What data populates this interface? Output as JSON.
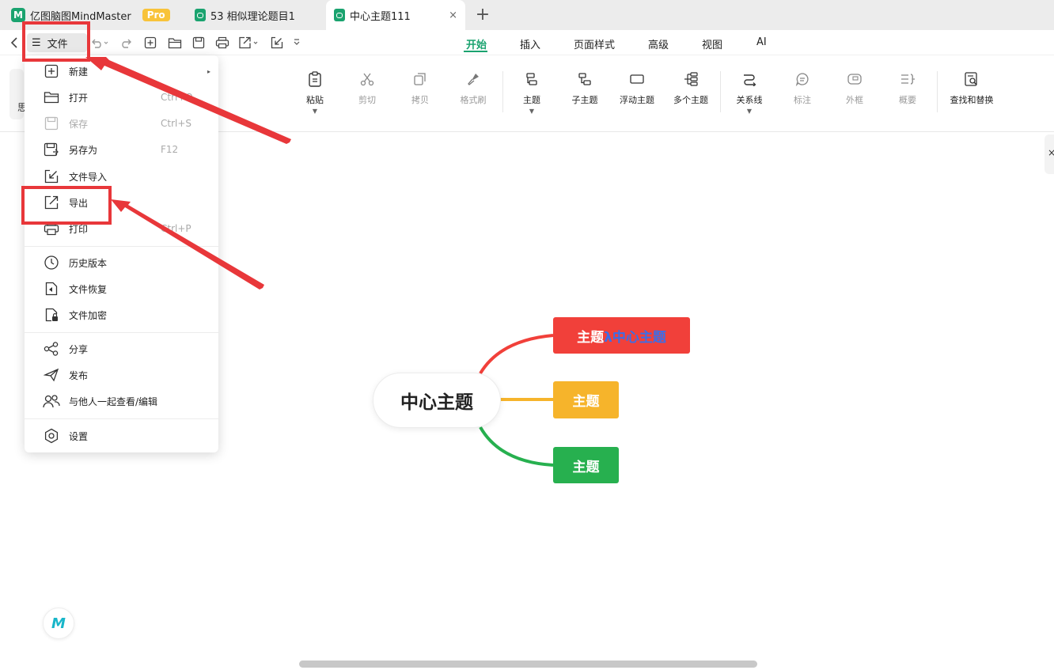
{
  "tabs": [
    {
      "label": "亿图脑图MindMaster",
      "badge": "Pro"
    },
    {
      "label": "53 相似理论题目1"
    },
    {
      "label": "中心主题111",
      "close": "×"
    }
  ],
  "add_tab": "+",
  "file_button": {
    "icon": "☰",
    "label": "文件"
  },
  "menu_tabs": [
    "开始",
    "插入",
    "页面样式",
    "高级",
    "视图",
    "AI"
  ],
  "ribbon": {
    "buttons": [
      {
        "label": "粘贴",
        "icon": "clipboard-icon",
        "caret": true
      },
      {
        "label": "剪切",
        "icon": "scissors-icon"
      },
      {
        "label": "拷贝",
        "icon": "copy-icon"
      },
      {
        "label": "格式刷",
        "icon": "brush-icon"
      },
      {
        "label": "主题",
        "icon": "topic-icon",
        "caret": true
      },
      {
        "label": "子主题",
        "icon": "subtopic-icon"
      },
      {
        "label": "浮动主题",
        "icon": "floating-topic-icon"
      },
      {
        "label": "多个主题",
        "icon": "multi-topic-icon"
      },
      {
        "label": "关系线",
        "icon": "relation-icon",
        "caret": true
      },
      {
        "label": "标注",
        "icon": "callout-icon"
      },
      {
        "label": "外框",
        "icon": "boundary-icon"
      },
      {
        "label": "概要",
        "icon": "summary-icon"
      },
      {
        "label": "查找和替换",
        "icon": "find-replace-icon"
      }
    ],
    "left_stub": "思",
    "right_stub": "×"
  },
  "file_menu": {
    "items": [
      {
        "label": "新建",
        "icon": "plus-square-icon",
        "submenu": "▸"
      },
      {
        "label": "打开",
        "icon": "folder-icon",
        "shortcut": "Ctrl+O"
      },
      {
        "label": "保存",
        "icon": "save-icon",
        "shortcut": "Ctrl+S",
        "disabled": true
      },
      {
        "label": "另存为",
        "icon": "save-as-icon",
        "shortcut": "F12"
      },
      {
        "label": "文件导入",
        "icon": "import-icon"
      },
      {
        "label": "导出",
        "icon": "export-icon"
      },
      {
        "label": "打印",
        "icon": "printer-icon",
        "shortcut": "Ctrl+P"
      },
      {
        "label": "历史版本",
        "icon": "history-icon"
      },
      {
        "label": "文件恢复",
        "icon": "recover-icon"
      },
      {
        "label": "文件加密",
        "icon": "lock-file-icon"
      },
      {
        "label": "分享",
        "icon": "share-icon"
      },
      {
        "label": "发布",
        "icon": "send-icon"
      },
      {
        "label": "与他人一起查看/编辑",
        "icon": "collaborate-icon"
      },
      {
        "label": "设置",
        "icon": "settings-icon"
      }
    ]
  },
  "mindmap": {
    "central": "中心主题",
    "topics": [
      {
        "label": "主题",
        "overlay": "λ中心主题",
        "color": "#f1403a"
      },
      {
        "label": "主题",
        "color": "#f6b42b"
      },
      {
        "label": "主题",
        "color": "#27b04f"
      }
    ]
  },
  "highlight_color": "#e8373a",
  "accent_color": "#1aa36f"
}
